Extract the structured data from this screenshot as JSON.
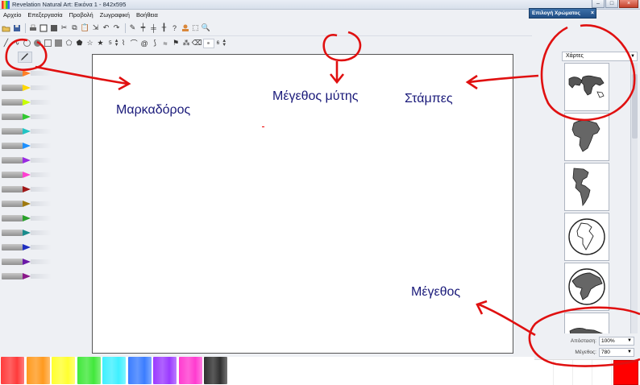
{
  "window": {
    "title": "Revelation Natural Art: Εικόνα 1 - 842x595",
    "controls": [
      "–",
      "□",
      "×"
    ]
  },
  "menu": [
    "Αρχείο",
    "Επεξεργασία",
    "Προβολή",
    "Ζωγραφική",
    "Βοήθεια"
  ],
  "color_chooser": {
    "title": "Επιλογή Χρώματος",
    "close": "×"
  },
  "toolbar": {
    "brush_size": "5",
    "tip_size": "6"
  },
  "annotations": {
    "marker": "Μαρκαδόρος",
    "tip_size": "Μέγεθος μύτης",
    "stamps": "Στάμπες",
    "size": "Μέγεθος"
  },
  "stamps": {
    "category": "Χάρτες",
    "items": [
      "world-map",
      "africa",
      "americas",
      "globe-europe-africa",
      "globe-shaded",
      "world-map-small"
    ]
  },
  "properties": {
    "distance_label": "Απόσταση:",
    "distance_value": "100%",
    "size_label": "Μέγεθος:",
    "size_value": "780"
  },
  "markers": [
    "#ff7f27",
    "#ffd800",
    "#c8ff00",
    "#32c832",
    "#22c4c4",
    "#1e90ff",
    "#9a2be2",
    "#ff3fd0",
    "#a01818",
    "#a07a10",
    "#2aa02a",
    "#1a8c8c",
    "#2030c0",
    "#6a1aa8",
    "#8a1a8a"
  ],
  "palette": [
    "#ff3b3b",
    "#ff9a1f",
    "#ffff30",
    "#41e83b",
    "#3ff0ff",
    "#3b7dff",
    "#9b3bff",
    "#ff3bd0",
    "#303030"
  ],
  "current_color": "#ff0000"
}
